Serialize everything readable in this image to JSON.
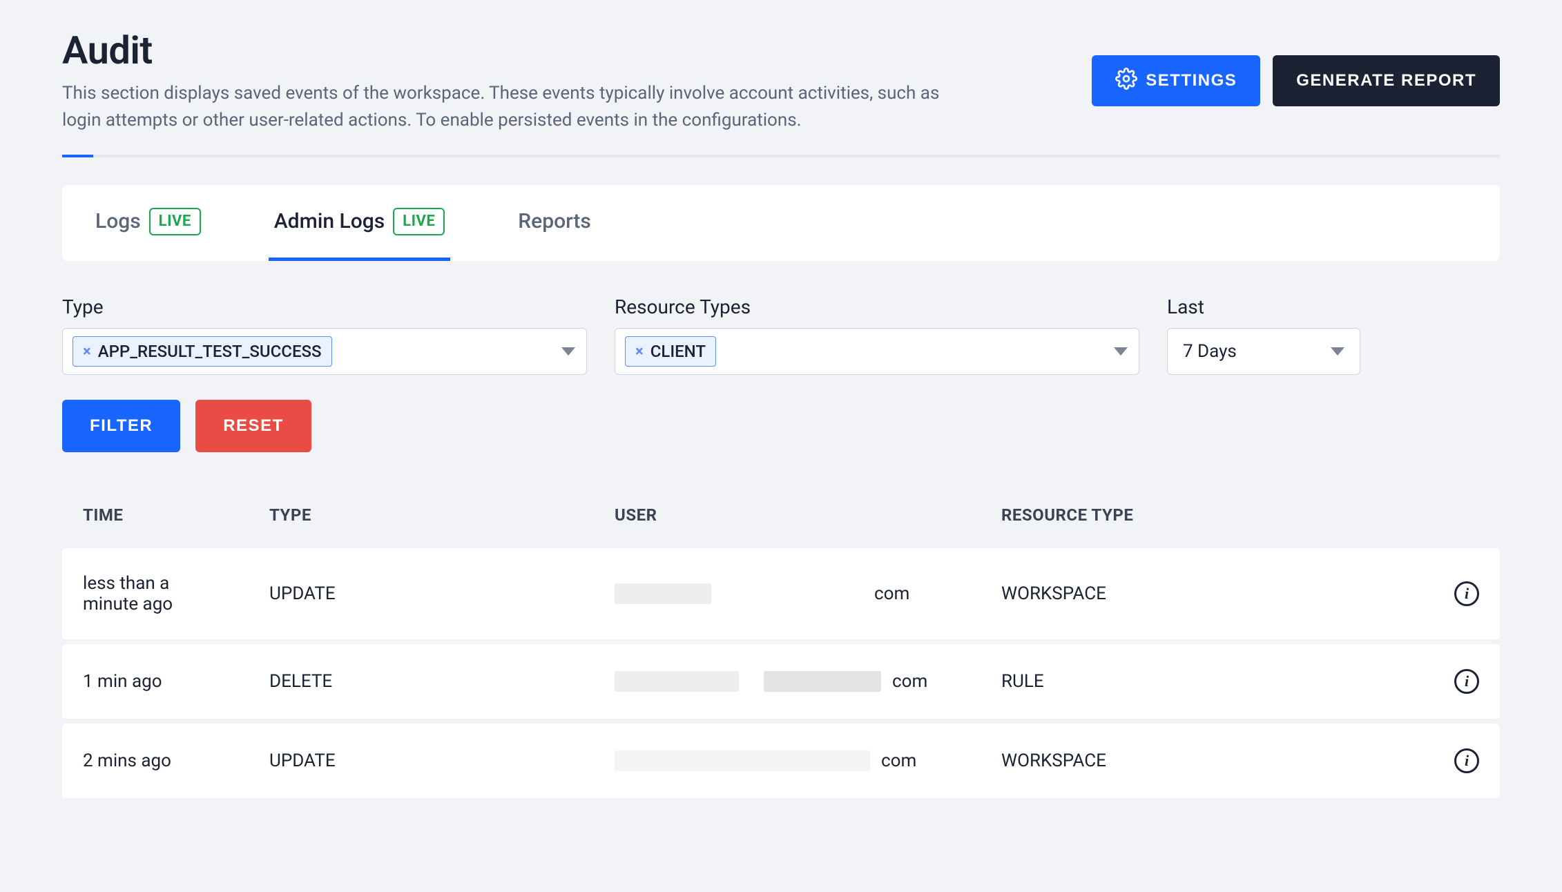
{
  "header": {
    "title": "Audit",
    "description": "This section displays saved events of the workspace. These events typically involve account activities, such as login attempts or other user-related actions. To enable persisted events in the configurations.",
    "settings_label": "SETTINGS",
    "generate_report_label": "GENERATE REPORT"
  },
  "tabs": {
    "items": [
      {
        "label": "Logs",
        "live": true,
        "active": false
      },
      {
        "label": "Admin Logs",
        "live": true,
        "active": true
      },
      {
        "label": "Reports",
        "live": false,
        "active": false
      }
    ],
    "live_badge": "LIVE"
  },
  "filters": {
    "type_label": "Type",
    "type_chips": [
      "APP_RESULT_TEST_SUCCESS"
    ],
    "resource_label": "Resource Types",
    "resource_chips": [
      "CLIENT"
    ],
    "last_label": "Last",
    "last_value": "7 Days",
    "filter_button": "FILTER",
    "reset_button": "RESET"
  },
  "table": {
    "columns": {
      "time": "TIME",
      "type": "TYPE",
      "user": "USER",
      "resource_type": "RESOURCE TYPE"
    },
    "rows": [
      {
        "time": "less than a minute ago",
        "type": "UPDATE",
        "user_suffix": "com",
        "resource_type": "WORKSPACE"
      },
      {
        "time": "1 min ago",
        "type": "DELETE",
        "user_suffix": "com",
        "resource_type": "RULE"
      },
      {
        "time": "2 mins ago",
        "type": "UPDATE",
        "user_suffix": "com",
        "resource_type": "WORKSPACE"
      }
    ]
  },
  "colors": {
    "primary": "#1866ff",
    "danger": "#e94b45",
    "live": "#1ca94c",
    "dark": "#1a2233"
  }
}
